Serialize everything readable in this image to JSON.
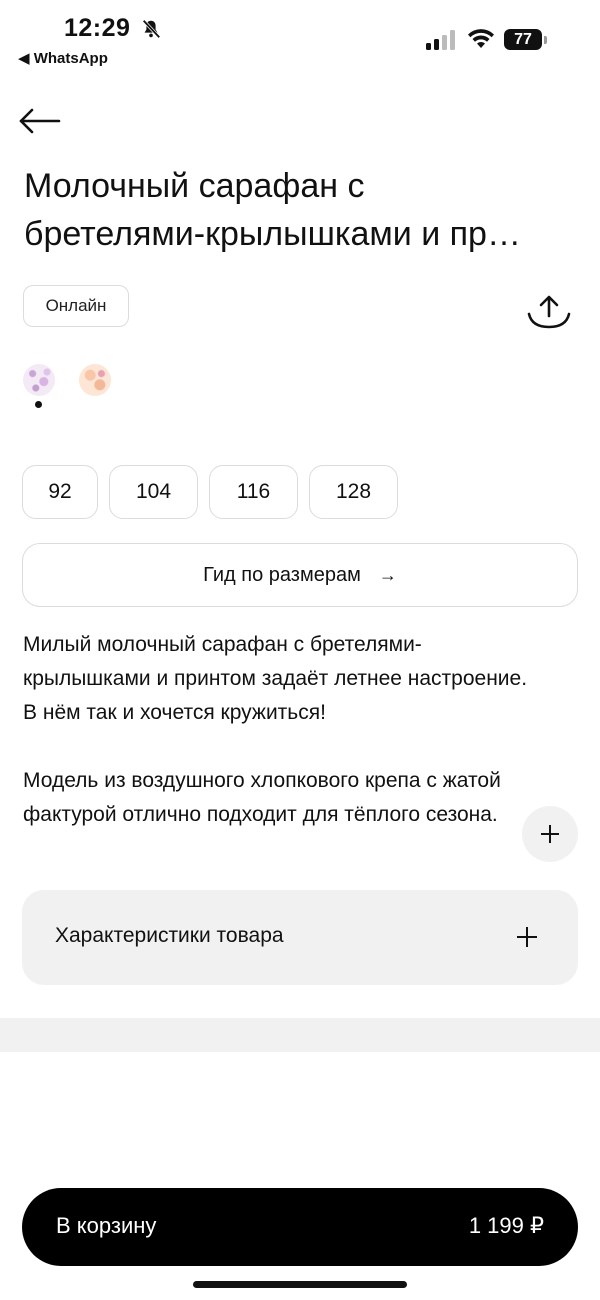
{
  "status_bar": {
    "time": "12:29",
    "back_app": "◀ WhatsApp",
    "battery": "77"
  },
  "product": {
    "title_line1": "Молочный сарафан с",
    "title_line2": "бретелями-крылышками и пр…",
    "badge": "Онлайн",
    "sizes": [
      "92",
      "104",
      "116",
      "128"
    ],
    "size_guide": "Гид по размерам",
    "size_guide_arrow": "→",
    "description_p1": "Милый молочный сарафан с бретелями-крылышками и принтом задаёт летнее настроение. В нём так и хочется кружиться!",
    "description_p2": "Модель из воздушного хлопкового крепа с жатой фактурой отлично подходит для тёплого сезона.",
    "specs_label": "Характеристики товара"
  },
  "cart": {
    "label": "В корзину",
    "price": "1 199 ₽"
  },
  "icons": {
    "back": "arrow-left-icon",
    "share": "share-icon",
    "expand": "plus-icon",
    "specs_expand": "plus-icon",
    "bell": "bell-slash-icon",
    "signal": "signal-icon",
    "wifi": "wifi-icon"
  },
  "colors": {
    "primary_button": "#000000",
    "muted_bg": "#f1f1f1",
    "border": "#dcdcdc"
  }
}
